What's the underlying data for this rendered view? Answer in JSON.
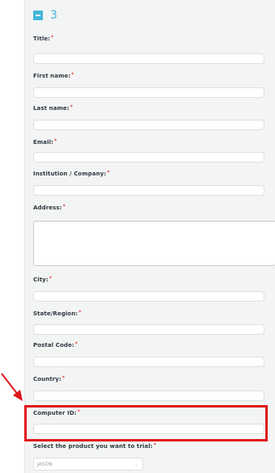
{
  "section": {
    "number": "3"
  },
  "required_marker": "*",
  "fields": {
    "title": "Title:",
    "first_name": "First name:",
    "last_name": "Last name:",
    "email": "Email:",
    "institution": "Institution / Company:",
    "address": "Address:",
    "city": "City:",
    "state": "State/Region:",
    "postal_code": "Postal Code:",
    "country": "Country:",
    "computer_id": "Computer ID:",
    "product": "Select the product you want to trial:"
  },
  "product_select": {
    "value": "JASON"
  },
  "icons": {
    "collapse": "minus-icon",
    "select": "chevron-down-icon",
    "annotation": "arrow-icon"
  },
  "colors": {
    "accent": "#41b6d9",
    "required": "#e53935",
    "highlight": "#e0161a"
  }
}
